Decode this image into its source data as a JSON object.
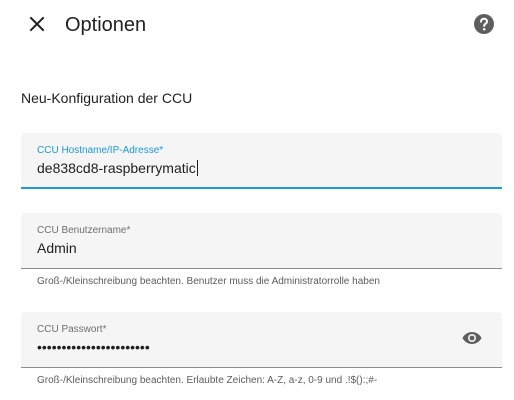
{
  "header": {
    "title": "Optionen",
    "close_icon": "close-icon",
    "help_icon": "help-circle-icon"
  },
  "section": {
    "title": "Neu-Konfiguration der CCU"
  },
  "fields": {
    "hostname": {
      "label": "CCU Hostname/IP-Adresse*",
      "value": "de838cd8-raspberrymatic",
      "focused": true
    },
    "username": {
      "label": "CCU Benutzername*",
      "value": "Admin",
      "helper": "Groß-/Kleinschreibung beachten. Benutzer muss die Administratorrolle haben"
    },
    "password": {
      "label": "CCU Passwort*",
      "value": "•••••••••••••••••••••••",
      "helper": "Groß-/Kleinschreibung beachten. Erlaubte Zeichen: A-Z, a-z, 0-9 und .!$():;#-",
      "toggle_icon": "eye-icon"
    }
  },
  "colors": {
    "accent": "#1a9bd7",
    "field_background": "#f5f5f5",
    "text": "#212121",
    "label": "#6f6f6f"
  }
}
